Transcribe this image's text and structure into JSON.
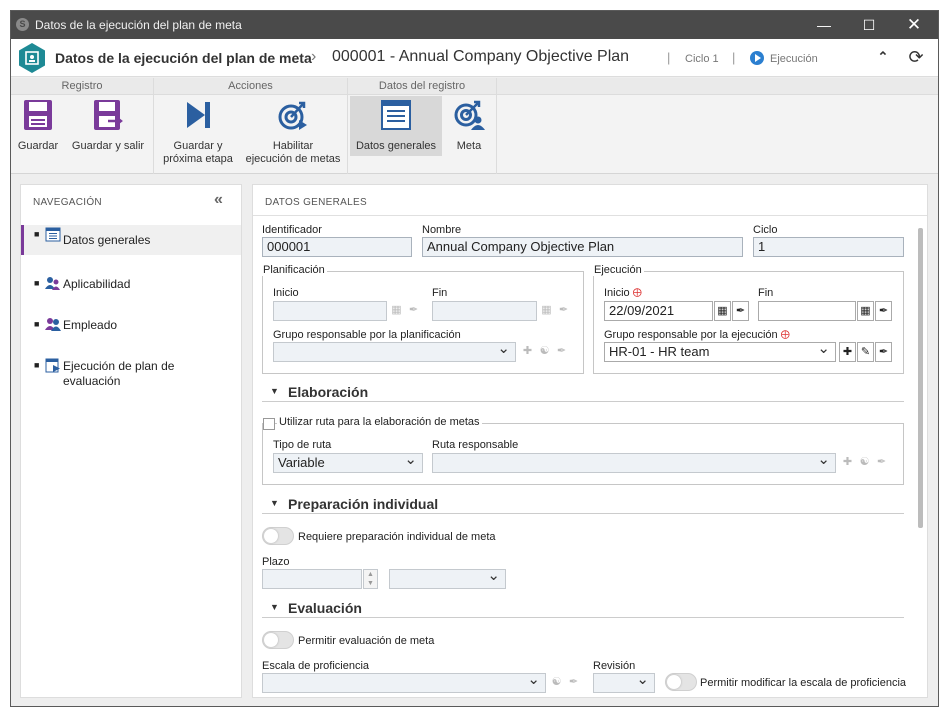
{
  "window": {
    "title": "Datos de la ejecución del plan de meta"
  },
  "header": {
    "title": "Datos de la ejecución del plan de meta",
    "separator": "›",
    "code": "000001 - Annual Company Objective Plan",
    "cycle": "Ciclo 1",
    "status": "Ejecución"
  },
  "ribbon": {
    "groups": [
      {
        "label": "Registro"
      },
      {
        "label": "Acciones"
      },
      {
        "label": "Datos del registro"
      }
    ],
    "buttons": {
      "save": "Guardar",
      "save_exit": "Guardar y salir",
      "save_next_l1": "Guardar y",
      "save_next_l2": "próxima etapa",
      "enable_l1": "Habilitar",
      "enable_l2": "ejecución de metas",
      "general": "Datos generales",
      "goal": "Meta"
    }
  },
  "nav": {
    "title": "NAVEGACIÓN",
    "items": [
      {
        "label": "Datos generales"
      },
      {
        "label": "Aplicabilidad"
      },
      {
        "label": "Empleado"
      },
      {
        "label_l1": "Ejecución de plan de",
        "label_l2": "evaluación"
      }
    ]
  },
  "main": {
    "title": "DATOS GENERALES",
    "identifier": {
      "label": "Identificador",
      "value": "000001"
    },
    "name": {
      "label": "Nombre",
      "value": "Annual Company Objective Plan"
    },
    "cycle": {
      "label": "Ciclo",
      "value": "1"
    },
    "planning": {
      "legend": "Planificación",
      "start": "Inicio",
      "end": "Fin",
      "group": "Grupo responsable por la planificación"
    },
    "execution": {
      "legend": "Ejecución",
      "start": "Inicio",
      "start_value": "22/09/2021",
      "end": "Fin",
      "group": "Grupo responsable por la ejecución",
      "group_value": "HR-01 - HR team"
    },
    "elaboration": {
      "title": "Elaboración",
      "use_route": "Utilizar ruta para la elaboración de metas",
      "route_type": "Tipo de ruta",
      "route_type_value": "Variable",
      "route_resp": "Ruta responsable"
    },
    "individual": {
      "title": "Preparación individual",
      "requires": "Requiere preparación individual de meta",
      "term": "Plazo"
    },
    "evaluation": {
      "title": "Evaluación",
      "allow": "Permitir evaluación de meta",
      "scale": "Escala de proficiencia",
      "revision": "Revisión",
      "allow_modify": "Permitir modificar la escala de proficiencia"
    }
  },
  "colors": {
    "accent": "#7a3a9a",
    "icon_blue": "#2b5fa0",
    "logo_teal": "#1e8a95"
  }
}
